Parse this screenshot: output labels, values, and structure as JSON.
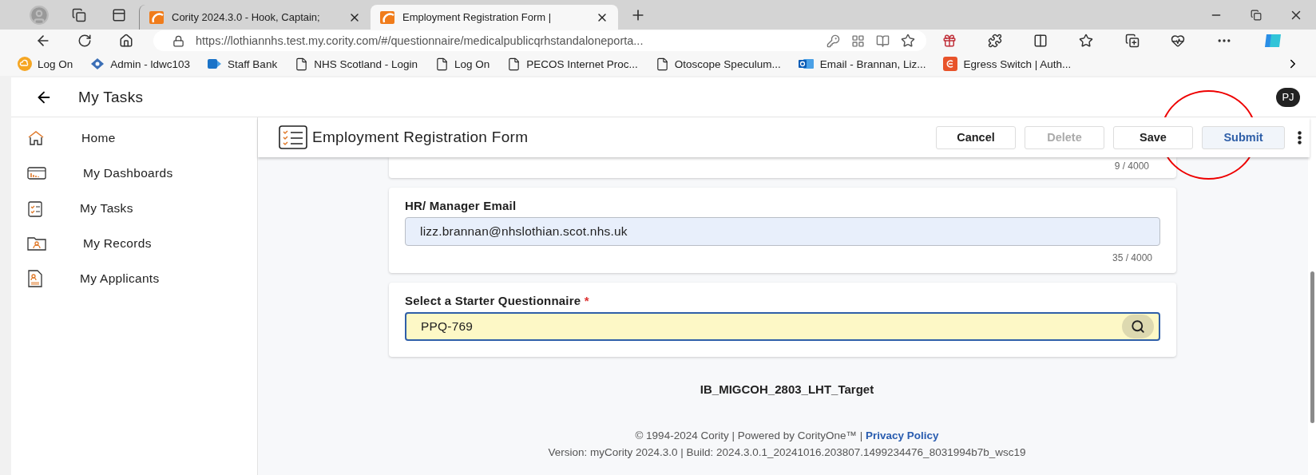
{
  "browser": {
    "tabs": [
      {
        "title": "Cority 2024.3.0 - Hook, Captain;",
        "selected": false
      },
      {
        "title": "Employment Registration Form |",
        "selected": true
      }
    ],
    "url": "https://lothiannhs.test.my.cority.com/#/questionnaire/medicalpublicqrhstandaloneporta...",
    "bookmarks": [
      {
        "label": "Log On",
        "kind": "cloud"
      },
      {
        "label": "Admin - ldwc103",
        "kind": "diamond"
      },
      {
        "label": "Staff Bank",
        "kind": "share"
      },
      {
        "label": "NHS Scotland - Login",
        "kind": "page"
      },
      {
        "label": "Log On",
        "kind": "page"
      },
      {
        "label": "PECOS Internet Proc...",
        "kind": "page"
      },
      {
        "label": "Otoscope Speculum...",
        "kind": "page"
      },
      {
        "label": "Email - Brannan, Liz...",
        "kind": "mail"
      },
      {
        "label": "Egress Switch | Auth...",
        "kind": "egress"
      }
    ]
  },
  "app_header": {
    "title": "My Tasks",
    "avatar": "PJ"
  },
  "sidebar": {
    "items": [
      {
        "label": "Home",
        "kind": "home"
      },
      {
        "label": "My Dashboards",
        "kind": "dashboard"
      },
      {
        "label": "My Tasks",
        "kind": "tasks"
      },
      {
        "label": "My Records",
        "kind": "records"
      },
      {
        "label": "My Applicants",
        "kind": "applicants"
      }
    ]
  },
  "form": {
    "title": "Employment Registration Form",
    "buttons": [
      {
        "label": "Cancel",
        "kind": "default",
        "disabled": false
      },
      {
        "label": "Delete",
        "kind": "default",
        "disabled": true
      },
      {
        "label": "Save",
        "kind": "default",
        "disabled": false
      },
      {
        "label": "Submit",
        "kind": "primary",
        "disabled": false
      }
    ],
    "fields": [
      {
        "kind": "partial",
        "counter": "9 / 4000"
      },
      {
        "kind": "text",
        "label": "HR/ Manager Email",
        "value": "lizz.brannan@nhslothian.scot.nhs.uk",
        "counter": "35 / 4000"
      },
      {
        "kind": "lookup",
        "label": "Select a Starter Questionnaire",
        "required_mark": "*",
        "value": "PPQ-769"
      }
    ]
  },
  "environment": "IB_MIGCOH_2803_LHT_Target",
  "footer": {
    "copyright": "© 1994-2024 Cority | Powered by CorityOne™ |",
    "privacy_link": "Privacy Policy",
    "version": "Version: myCority 2024.3.0 | Build: 2024.3.0.1_20241016.203807.1499234476_8031994b7b_wsc19"
  }
}
